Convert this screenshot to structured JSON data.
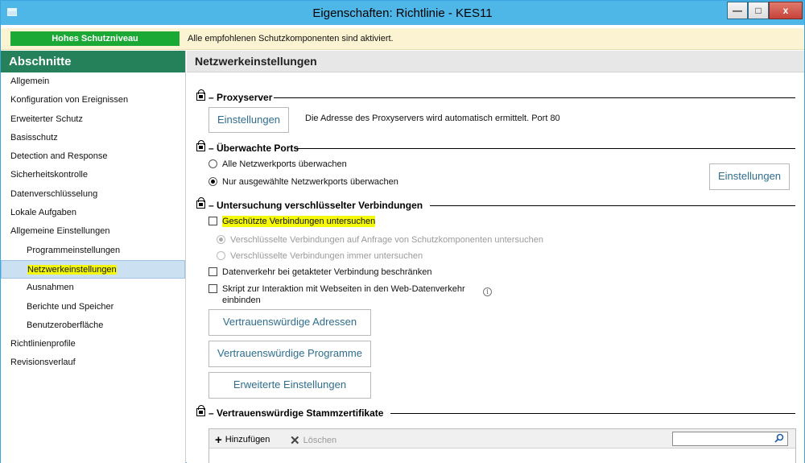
{
  "window": {
    "title": "Eigenschaften: Richtlinie - KES11"
  },
  "banner": {
    "level": "Hohes Schutzniveau",
    "message": "Alle empfohlenen Schutzkomponenten sind aktiviert.",
    "level_color": "#1aa935"
  },
  "sidebar": {
    "header": "Abschnitte",
    "items": [
      {
        "label": "Allgemein"
      },
      {
        "label": "Konfiguration von Ereignissen"
      },
      {
        "label": "Erweiterter Schutz"
      },
      {
        "label": "Basisschutz"
      },
      {
        "label": "Detection and Response"
      },
      {
        "label": "Sicherheitskontrolle"
      },
      {
        "label": "Datenverschlüsselung"
      },
      {
        "label": "Lokale Aufgaben"
      },
      {
        "label": "Allgemeine Einstellungen"
      },
      {
        "label": "Programmeinstellungen"
      },
      {
        "label": "Netzwerkeinstellungen"
      },
      {
        "label": "Ausnahmen"
      },
      {
        "label": "Berichte und Speicher"
      },
      {
        "label": "Benutzeroberfläche"
      },
      {
        "label": "Richtlinienprofile"
      },
      {
        "label": "Revisionsverlauf"
      }
    ],
    "header_color": "#24815a"
  },
  "main": {
    "title": "Netzwerkeinstellungen",
    "proxy": {
      "title": "Proxyserver",
      "button": "Einstellungen",
      "note": "Die Adresse des Proxyservers wird automatisch ermittelt. Port 80"
    },
    "ports": {
      "title": "Überwachte Ports",
      "option_all": "Alle Netzwerkports überwachen",
      "option_selected": "Nur ausgewählte Netzwerkports überwachen",
      "button": "Einstellungen"
    },
    "encrypted": {
      "title": "Untersuchung verschlüsselter Verbindungen",
      "check_scan": "Geschützte Verbindungen untersuchen",
      "option_on_request": "Verschlüsselte Verbindungen auf Anfrage von Schutzkomponenten untersuchen",
      "option_always": "Verschlüsselte Verbindungen immer untersuchen",
      "check_metered": "Datenverkehr bei getakteter Verbindung beschränken",
      "check_script_line1": "Skript zur Interaktion mit Webseiten in den Web-Datenverkehr",
      "check_script_line2": "einbinden",
      "btn_addresses": "Vertrauenswürdige Adressen",
      "btn_programs": "Vertrauenswürdige Programme",
      "btn_advanced": "Erweiterte Einstellungen"
    },
    "certs": {
      "title": "Vertrauenswürdige Stammzertifikate",
      "add": "Hinzufügen",
      "delete": "Löschen",
      "search_value": ""
    }
  }
}
